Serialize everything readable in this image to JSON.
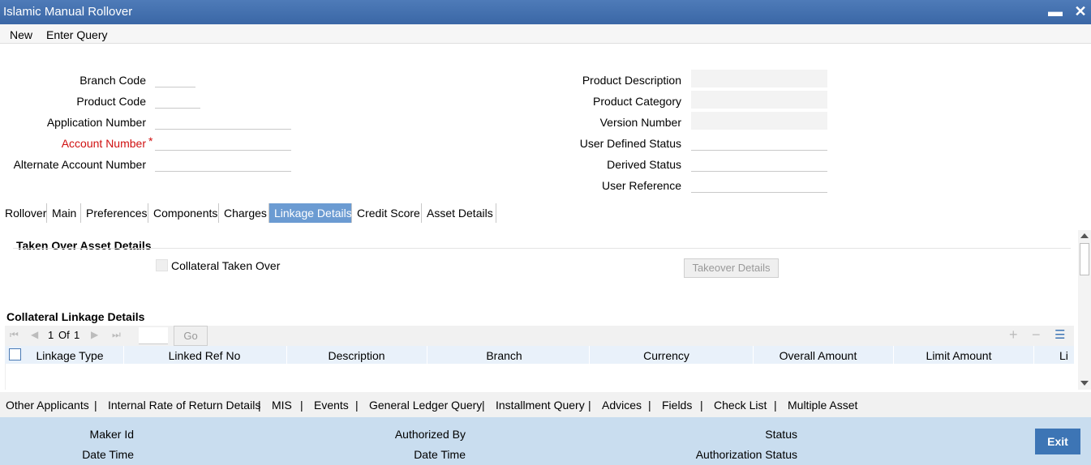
{
  "window": {
    "title": "Islamic Manual Rollover",
    "minimize_glyph": "▬",
    "close_glyph": "✕"
  },
  "menu": {
    "new": "New",
    "enter_query": "Enter Query"
  },
  "form_left": {
    "branch_code": "Branch Code",
    "product_code": "Product Code",
    "application_number": "Application Number",
    "account_number": "Account Number",
    "required_mark": "*",
    "alternate_account_number": "Alternate Account Number"
  },
  "form_right": {
    "product_description": "Product Description",
    "product_category": "Product Category",
    "version_number": "Version Number",
    "user_defined_status": "User Defined Status",
    "derived_status": "Derived Status",
    "user_reference": "User Reference"
  },
  "tabs": [
    "Rollover",
    "Main",
    "Preferences",
    "Components",
    "Charges",
    "Linkage Details",
    "Credit Score",
    "Asset Details"
  ],
  "active_tab": "Linkage Details",
  "taken_over": {
    "title": "Taken Over Asset Details",
    "collateral_taken_over": "Collateral Taken Over",
    "takeover_details_button": "Takeover Details"
  },
  "collateral_linkage": {
    "title": "Collateral Linkage Details",
    "pager": {
      "current": "1",
      "of_label": "Of",
      "total": "1",
      "go": "Go"
    },
    "columns": [
      "Linkage Type",
      "Linked Ref No",
      "Description",
      "Branch",
      "Currency",
      "Overall Amount",
      "Limit Amount",
      "Li"
    ]
  },
  "subsystems": [
    "Other Applicants",
    "Internal Rate of Return Details",
    "MIS",
    "Events",
    "General Ledger Query",
    "Installment Query",
    "Advices",
    "Fields",
    "Check List",
    "Multiple Asset"
  ],
  "footer": {
    "maker_id": "Maker Id",
    "date_time_1": "Date Time",
    "authorized_by": "Authorized By",
    "date_time_2": "Date Time",
    "status": "Status",
    "authorization_status": "Authorization Status",
    "exit": "Exit"
  },
  "colors": {
    "titlebar": "#3a67a6",
    "active_tab": "#6b9bd2",
    "footer": "#c9ddef",
    "exit_button": "#3d75b5",
    "required": "#d01010"
  }
}
